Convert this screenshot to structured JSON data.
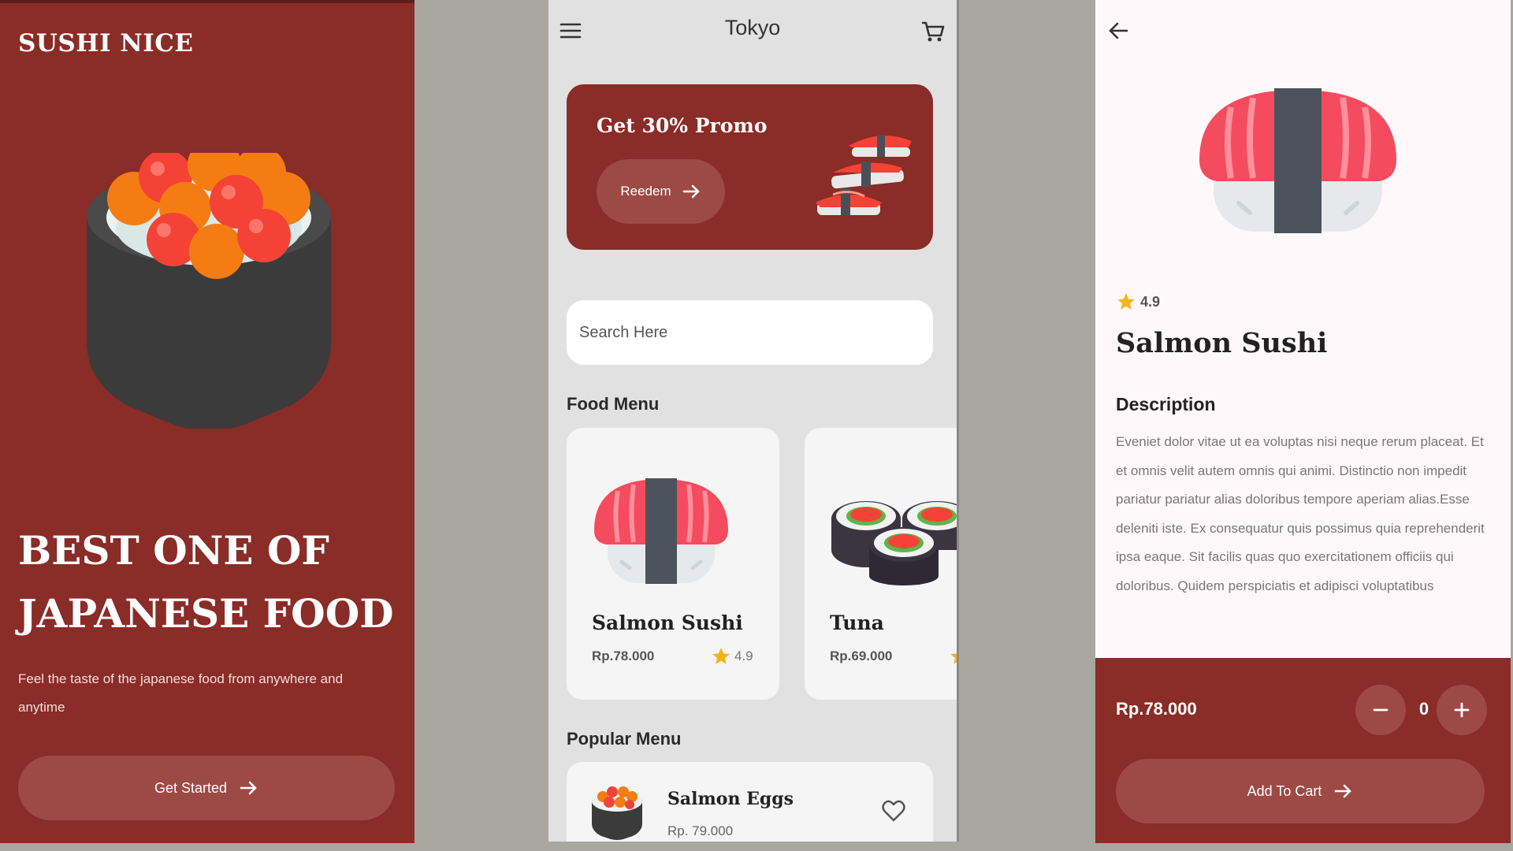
{
  "splash": {
    "brand": "SUSHI NICE",
    "headline": "BEST ONE OF JAPANESE FOOD",
    "tagline": "Feel the taste of the japanese food from anywhere and anytime",
    "button_label": "Get Started"
  },
  "home": {
    "location": "Tokyo",
    "promo": {
      "title": "Get 30% Promo",
      "button_label": "Reedem"
    },
    "search": {
      "placeholder": "Search Here"
    },
    "food_menu_title": "Food Menu",
    "food_menu": [
      {
        "name": "Salmon Sushi",
        "price": "Rp.78.000",
        "rating": "4.9"
      },
      {
        "name": "Tuna",
        "price": "Rp.69.000",
        "rating": ""
      }
    ],
    "popular_menu_title": "Popular Menu",
    "popular_menu": [
      {
        "name": "Salmon Eggs",
        "price": "Rp. 79.000"
      }
    ]
  },
  "detail": {
    "rating": "4.9",
    "title": "Salmon Sushi",
    "description_heading": "Description",
    "description": "Eveniet dolor vitae ut ea voluptas nisi neque rerum placeat. Et et omnis velit autem omnis qui animi. Distinctio non impedit pariatur pariatur alias doloribus tempore aperiam alias.Esse deleniti iste. Ex consequatur quis possimus quia reprehenderit ipsa eaque. Sit facilis quas quo exercitationem officiis qui doloribus. Quidem perspiciatis et adipisci voluptatibus",
    "price": "Rp.78.000",
    "quantity": "0",
    "add_to_cart_label": "Add To Cart"
  },
  "colors": {
    "primary": "#8a2c27",
    "button": "#9d4a45",
    "star": "#f3b51d"
  },
  "icons": [
    "menu-icon",
    "cart-icon",
    "arrow-right-icon",
    "star-icon",
    "heart-icon",
    "back-arrow-icon",
    "minus-icon",
    "plus-icon"
  ]
}
